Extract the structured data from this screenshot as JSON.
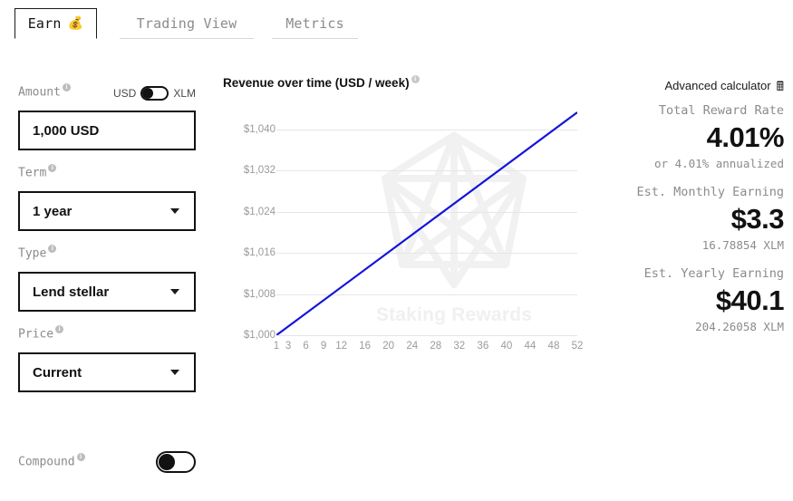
{
  "tabs": [
    {
      "label": "Earn",
      "icon": "money-bag-icon",
      "glyph": "💰",
      "active": true
    },
    {
      "label": "Trading View",
      "active": false
    },
    {
      "label": "Metrics",
      "active": false
    }
  ],
  "form": {
    "amount": {
      "label": "Amount",
      "value": "1,000 USD",
      "placeholder": "1,000 USD",
      "currency_left": "USD",
      "currency_right": "XLM",
      "toggle_state": "USD"
    },
    "term": {
      "label": "Term",
      "value": "1 year"
    },
    "type": {
      "label": "Type",
      "value": "Lend stellar"
    },
    "price": {
      "label": "Price",
      "value": "Current"
    },
    "compound": {
      "label": "Compound",
      "state": "off"
    },
    "info_glyph": "i"
  },
  "chart": {
    "title": "Revenue over time (USD / week)",
    "watermark_text": "Staking Rewards",
    "line_color": "#1414dc",
    "grid_color": "#e6e6e6"
  },
  "chart_data": {
    "type": "line",
    "title": "Revenue over time (USD / week)",
    "xlabel": "",
    "ylabel": "",
    "xlim": [
      1,
      52
    ],
    "ylim": [
      1000,
      1044
    ],
    "grid": true,
    "legend": null,
    "yticks": [
      "$1,000",
      "$1,008",
      "$1,016",
      "$1,024",
      "$1,032",
      "$1,040"
    ],
    "ytick_values": [
      1000,
      1008,
      1016,
      1024,
      1032,
      1040
    ],
    "xticks": [
      "1",
      "3",
      "6",
      "9",
      "12",
      "16",
      "20",
      "24",
      "28",
      "32",
      "36",
      "40",
      "44",
      "48",
      "52"
    ],
    "xtick_values": [
      1,
      3,
      6,
      9,
      12,
      16,
      20,
      24,
      28,
      32,
      36,
      40,
      44,
      48,
      52
    ],
    "series": [
      {
        "name": "Revenue",
        "color": "#1414dc",
        "x": [
          1,
          52
        ],
        "values": [
          1000,
          1043.3
        ]
      }
    ]
  },
  "results": {
    "advanced_calculator": "Advanced calculator",
    "calculator_icon": "🖩",
    "items": [
      {
        "label": "Total Reward Rate",
        "value": "4.01%",
        "sub": "or 4.01% annualized"
      },
      {
        "label": "Est. Monthly Earning",
        "value": "$3.3",
        "sub": "16.78854 XLM"
      },
      {
        "label": "Est. Yearly Earning",
        "value": "$40.1",
        "sub": "204.26058 XLM"
      }
    ]
  }
}
